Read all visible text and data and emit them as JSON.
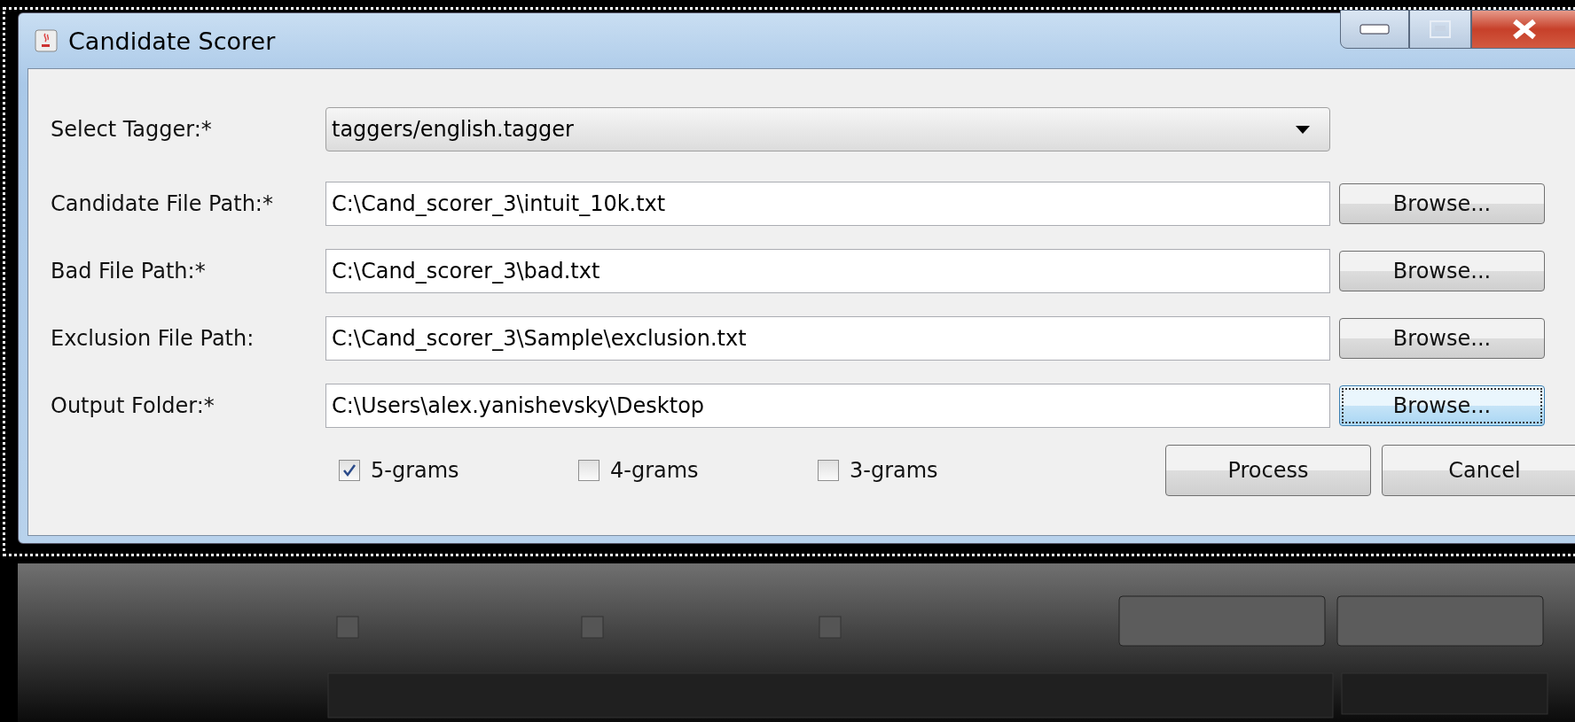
{
  "window": {
    "title": "Candidate Scorer"
  },
  "form": {
    "rows": [
      {
        "kind": "combo",
        "label": "Select Tagger:*",
        "value": "taggers/english.tagger"
      },
      {
        "kind": "file",
        "label": "Candidate File Path:*",
        "value": "C:\\Cand_scorer_3\\intuit_10k.txt",
        "button": "Browse...",
        "focused": false
      },
      {
        "kind": "file",
        "label": "Bad File Path:*",
        "value": "C:\\Cand_scorer_3\\bad.txt",
        "button": "Browse...",
        "focused": false
      },
      {
        "kind": "file",
        "label": "Exclusion File Path:",
        "value": "C:\\Cand_scorer_3\\Sample\\exclusion.txt",
        "button": "Browse...",
        "focused": false
      },
      {
        "kind": "file",
        "label": "Output Folder:*",
        "value": "C:\\Users\\alex.yanishevsky\\Desktop",
        "button": "Browse...",
        "focused": true
      }
    ],
    "options": [
      {
        "label": "5-grams",
        "checked": true
      },
      {
        "label": "4-grams",
        "checked": false
      },
      {
        "label": "3-grams",
        "checked": false
      }
    ],
    "buttons": [
      "Process",
      "Cancel"
    ]
  }
}
